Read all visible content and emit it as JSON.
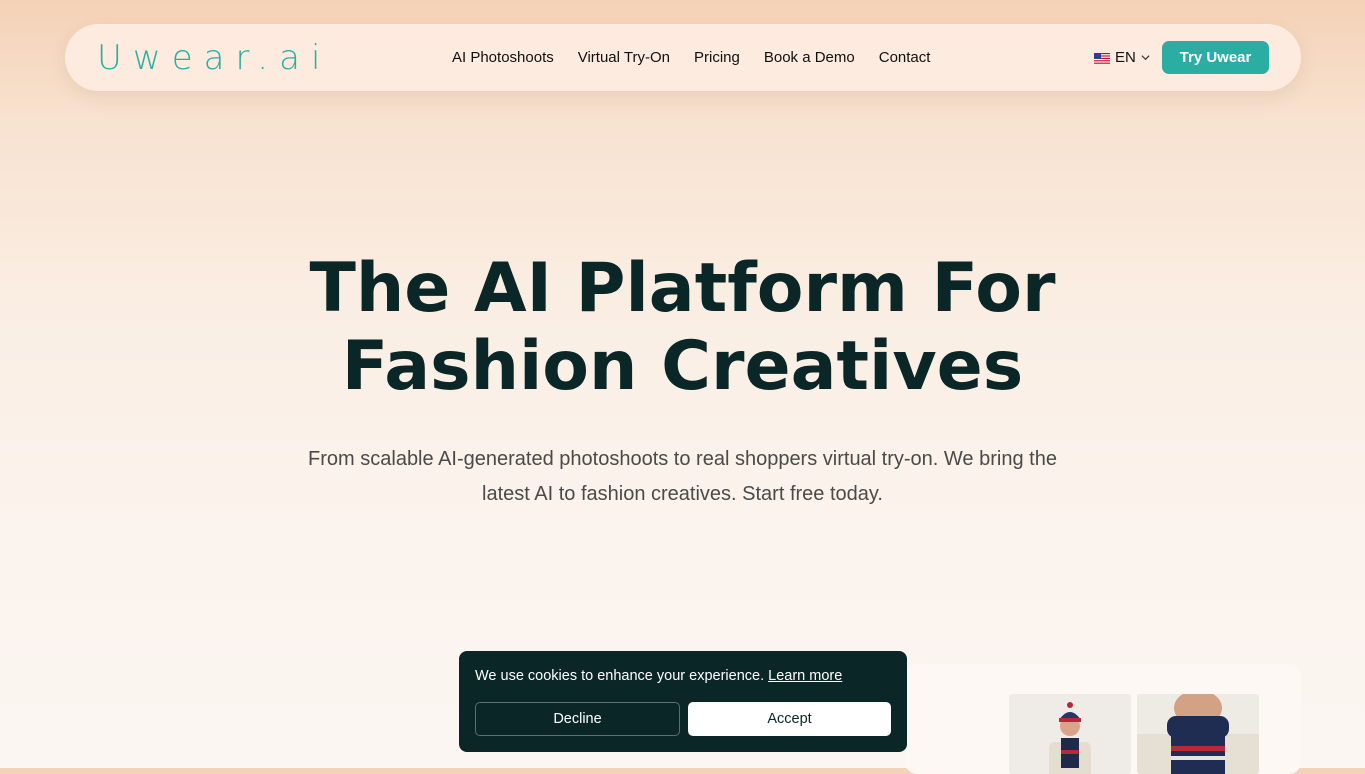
{
  "nav": {
    "logo": "Uwear.ai",
    "links": [
      {
        "label": "AI Photoshoots"
      },
      {
        "label": "Virtual Try-On"
      },
      {
        "label": "Pricing"
      },
      {
        "label": "Book a Demo"
      },
      {
        "label": "Contact"
      }
    ],
    "language": {
      "label": "EN",
      "flag_icon": "us-flag-icon",
      "chevron_icon": "chevron-down-icon"
    },
    "cta_label": "Try Uwear"
  },
  "hero": {
    "title_line1": "The AI Platform For",
    "title_line2": "Fashion Creatives",
    "subtitle": "From scalable AI-generated photoshoots to real shoppers virtual try-on. We bring the latest AI to fashion creatives. Start free today."
  },
  "cookie_banner": {
    "message": "We use cookies to enhance your experience.",
    "link_label": "Learn more",
    "decline_label": "Decline",
    "accept_label": "Accept"
  },
  "colors": {
    "brand_teal": "#2aaea3",
    "dark_teal": "#0b2626",
    "navbar_bg": "#fcebde"
  }
}
